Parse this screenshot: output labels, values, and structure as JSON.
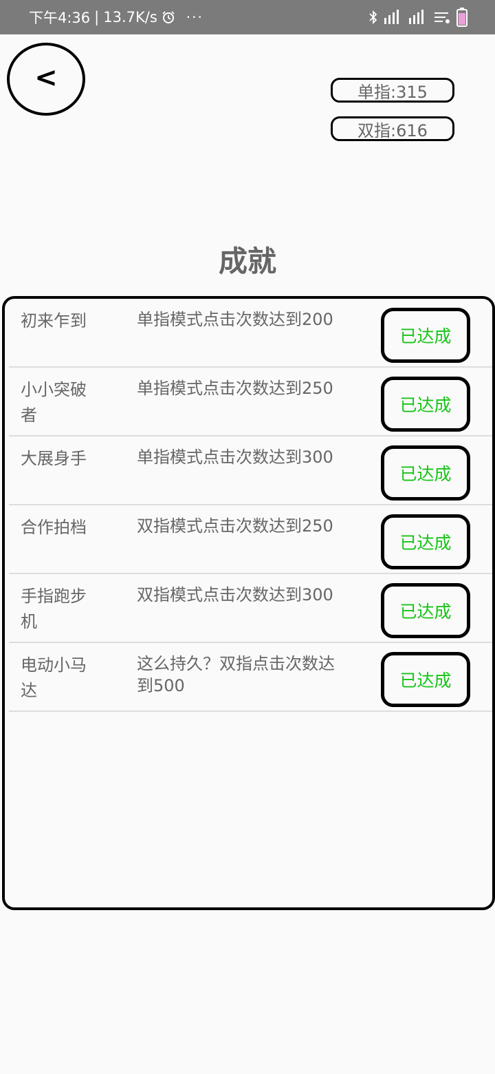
{
  "status_bar": {
    "time": "下午4:36",
    "speed": "13.7K/s",
    "alarm_icon": "alarm-clock-icon",
    "more": "···",
    "icons": [
      "bluetooth-icon",
      "signal-icon",
      "signal-icon",
      "wifi-icon",
      "battery-icon"
    ]
  },
  "header": {
    "back_label": "<",
    "single_count": "单指:315",
    "double_count": "双指:616"
  },
  "title": "成就",
  "achievements": [
    {
      "name": "初来乍到",
      "desc": "单指模式点击次数达到200",
      "status": "已达成"
    },
    {
      "name": "小小突破者",
      "desc": "单指模式点击次数达到250",
      "status": "已达成"
    },
    {
      "name": "大展身手",
      "desc": "单指模式点击次数达到300",
      "status": "已达成"
    },
    {
      "name": "合作拍档",
      "desc": "双指模式点击次数达到250",
      "status": "已达成"
    },
    {
      "name": "手指跑步机",
      "desc": "双指模式点击次数达到300",
      "status": "已达成"
    },
    {
      "name": "电动小马达",
      "desc": "这么持久？双指点击次数达到500",
      "status": "已达成"
    }
  ],
  "colors": {
    "status_green": "#17c417",
    "text_gray": "#666666",
    "status_bar_bg": "#7b7b7b"
  }
}
